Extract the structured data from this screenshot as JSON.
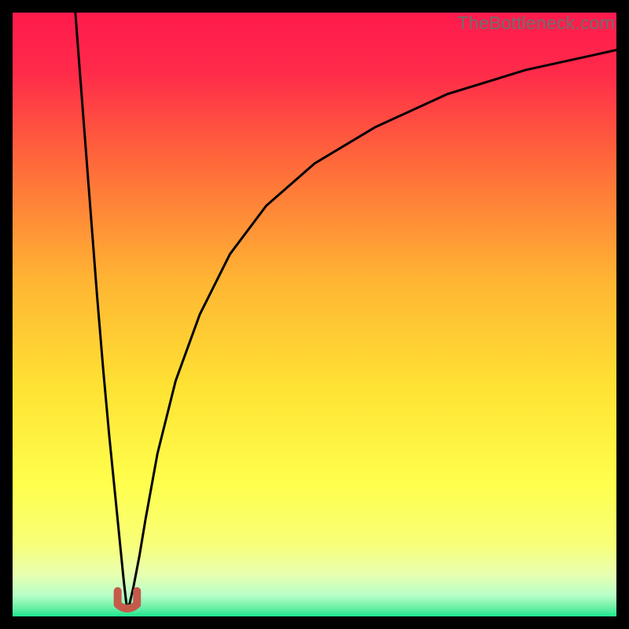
{
  "watermark": {
    "text": "TheBottleneck.com"
  },
  "colors": {
    "bg": "#000000",
    "gradient_stops": [
      {
        "offset": 0.0,
        "color": "#ff1a4d"
      },
      {
        "offset": 0.1,
        "color": "#ff2b4a"
      },
      {
        "offset": 0.25,
        "color": "#ff6a3a"
      },
      {
        "offset": 0.45,
        "color": "#ffb733"
      },
      {
        "offset": 0.62,
        "color": "#ffe233"
      },
      {
        "offset": 0.78,
        "color": "#ffff4d"
      },
      {
        "offset": 0.88,
        "color": "#f8ff78"
      },
      {
        "offset": 0.93,
        "color": "#e8ffb0"
      },
      {
        "offset": 0.965,
        "color": "#b8ffc8"
      },
      {
        "offset": 0.985,
        "color": "#6df0a8"
      },
      {
        "offset": 1.0,
        "color": "#1ee88f"
      }
    ],
    "curve": "#000000",
    "marker_fill": "#c55a4a",
    "marker_outline": "#c55a4a"
  },
  "chart_data": {
    "type": "line",
    "title": "",
    "xlabel": "",
    "ylabel": "",
    "xlim": [
      0,
      100
    ],
    "ylim": [
      0,
      100
    ],
    "grid": false,
    "legend": false,
    "optimum_x": 19,
    "series": [
      {
        "name": "left-branch",
        "x": [
          10.4,
          11,
          12,
          13,
          14,
          15,
          16,
          17,
          17.8,
          18.4,
          18.8,
          19
        ],
        "y": [
          100,
          92,
          79,
          66,
          53,
          41,
          30,
          20,
          12,
          6,
          2.5,
          1.2
        ]
      },
      {
        "name": "right-branch",
        "x": [
          19,
          19.4,
          20,
          21,
          22,
          24,
          27,
          31,
          36,
          42,
          50,
          60,
          72,
          85,
          100
        ],
        "y": [
          1.2,
          2.2,
          4.8,
          10,
          16,
          27,
          39,
          50,
          60,
          68,
          75,
          81,
          86.5,
          90.5,
          93.8
        ]
      }
    ],
    "marker": {
      "name": "optimum-marker",
      "shape": "u",
      "x": 19,
      "y": 1.2,
      "width_x": 3.2,
      "height_y": 3.0
    }
  }
}
